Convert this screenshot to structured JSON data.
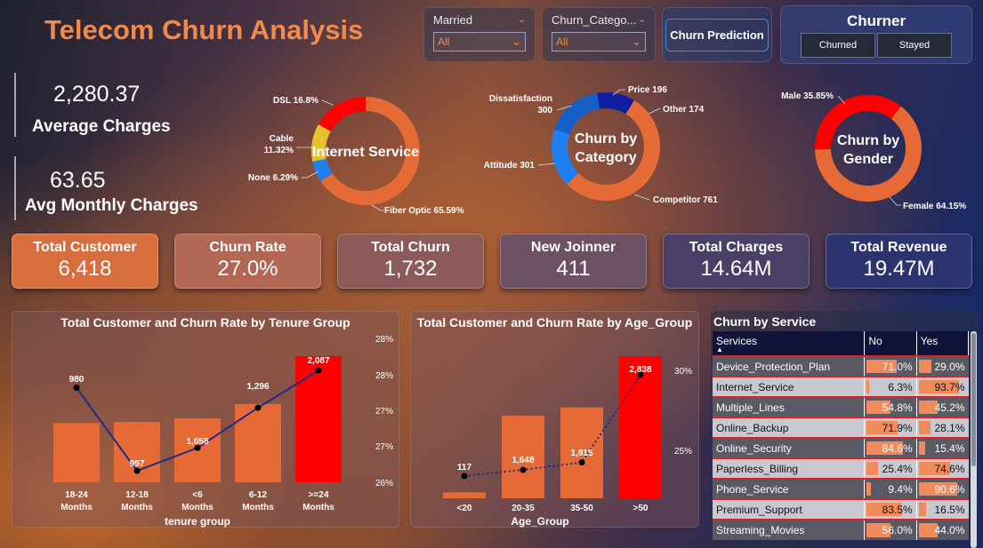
{
  "title": "Telecom Churn Analysis",
  "slicers": {
    "married": {
      "label": "Married",
      "value": "All"
    },
    "churn_category": {
      "label": "Churn_Catego...",
      "value": "All"
    }
  },
  "churn_prediction_button": "Churn Prediction",
  "churner": {
    "label": "Churner",
    "options": [
      "Churned",
      "Stayed"
    ]
  },
  "stats": {
    "avg_charges_value": "2,280.37",
    "avg_charges_label": "Average Charges",
    "avg_monthly_value": "63.65",
    "avg_monthly_label": "Avg Monthly Charges"
  },
  "kpis": [
    {
      "title": "Total Customer",
      "value": "6,418"
    },
    {
      "title": "Churn Rate",
      "value": "27.0%"
    },
    {
      "title": "Total Churn",
      "value": "1,732"
    },
    {
      "title": "New Joinner",
      "value": "411"
    },
    {
      "title": "Total Charges",
      "value": "14.64M"
    },
    {
      "title": "Total Revenue",
      "value": "19.47M"
    }
  ],
  "colors": {
    "orange": "#e56a35",
    "red": "#ff0000",
    "yellow": "#e6c22e",
    "blue": "#1e7ff0",
    "navy": "#101fa0",
    "mid_blue": "#1560c8",
    "line": "#1f2a8a"
  },
  "chart_data": [
    {
      "type": "pie",
      "title": "Internet Service",
      "slices": [
        {
          "label": "Fiber Optic",
          "value": 65.59,
          "text": "Fiber Optic 65.59%"
        },
        {
          "label": "None",
          "value": 6.29,
          "text": "None 6.29%"
        },
        {
          "label": "Cable",
          "value": 11.32,
          "text": "Cable 11.32%"
        },
        {
          "label": "DSL",
          "value": 16.8,
          "text": "DSL 16.8%"
        }
      ]
    },
    {
      "type": "pie",
      "title": "Churn by Category",
      "slices": [
        {
          "label": "Competitor",
          "value": 761,
          "text": "Competitor 761"
        },
        {
          "label": "Attitude",
          "value": 301,
          "text": "Attitude 301"
        },
        {
          "label": "Dissatisfaction",
          "value": 300,
          "text": "Dissatisfaction 300"
        },
        {
          "label": "Price",
          "value": 196,
          "text": "Price 196"
        },
        {
          "label": "Other",
          "value": 174,
          "text": "Other 174"
        }
      ]
    },
    {
      "type": "pie",
      "title": "Churn by Gender",
      "slices": [
        {
          "label": "Female",
          "value": 64.15,
          "text": "Female 64.15%"
        },
        {
          "label": "Male",
          "value": 35.85,
          "text": "Male 35.85%"
        }
      ]
    },
    {
      "type": "bar",
      "title": "Total Customer and Churn Rate by Tenure Group",
      "xlabel": "tenure group",
      "categories": [
        "18-24 Months",
        "12-18 Months",
        "<6 Months",
        "6-12 Months",
        ">=24 Months"
      ],
      "series": [
        {
          "name": "Total Customer",
          "values": [
            980,
            997,
            1058,
            1296,
            2087
          ],
          "labels": [
            "980",
            "997",
            "1,058",
            "1,296",
            "2,087"
          ]
        },
        {
          "name": "Churn Rate",
          "values": [
            27.65,
            26.2,
            26.6,
            27.3,
            27.95
          ]
        }
      ],
      "y2_ticks": [
        "28%",
        "28%",
        "27%",
        "27%",
        "26%"
      ],
      "y2lim": [
        26.0,
        28.2
      ]
    },
    {
      "type": "bar",
      "title": "Total Customer and Churn Rate by Age_Group",
      "xlabel": "Age_Group",
      "categories": [
        "<20",
        "20-35",
        "35-50",
        ">50"
      ],
      "series": [
        {
          "name": "Total Customer",
          "values": [
            117,
            1648,
            1815,
            2838
          ],
          "labels": [
            "117",
            "1,648",
            "1,815",
            "2,838"
          ]
        },
        {
          "name": "Churn Rate",
          "values": [
            23.3,
            23.8,
            24.4,
            31.5
          ]
        }
      ],
      "y2_ticks": [
        "30%",
        "25%"
      ],
      "y2lim": [
        21.5,
        33.0
      ]
    }
  ],
  "service_table": {
    "title": "Churn by Service",
    "headers": [
      "Services",
      "No",
      "Yes"
    ],
    "rows": [
      {
        "name": "Device_Protection_Plan",
        "no": "71.0%",
        "yes": "29.0%",
        "no_frac": 0.71,
        "yes_frac": 0.29
      },
      {
        "name": "Internet_Service",
        "no": "6.3%",
        "yes": "93.7%",
        "no_frac": 0.063,
        "yes_frac": 0.937
      },
      {
        "name": "Multiple_Lines",
        "no": "54.8%",
        "yes": "45.2%",
        "no_frac": 0.548,
        "yes_frac": 0.452
      },
      {
        "name": "Online_Backup",
        "no": "71.9%",
        "yes": "28.1%",
        "no_frac": 0.719,
        "yes_frac": 0.281
      },
      {
        "name": "Online_Security",
        "no": "84.6%",
        "yes": "15.4%",
        "no_frac": 0.846,
        "yes_frac": 0.154
      },
      {
        "name": "Paperless_Billing",
        "no": "25.4%",
        "yes": "74.6%",
        "no_frac": 0.254,
        "yes_frac": 0.746
      },
      {
        "name": "Phone_Service",
        "no": "9.4%",
        "yes": "90.6%",
        "no_frac": 0.094,
        "yes_frac": 0.906
      },
      {
        "name": "Premium_Support",
        "no": "83.5%",
        "yes": "16.5%",
        "no_frac": 0.835,
        "yes_frac": 0.165
      },
      {
        "name": "Streaming_Movies",
        "no": "56.0%",
        "yes": "44.0%",
        "no_frac": 0.56,
        "yes_frac": 0.44
      }
    ]
  }
}
